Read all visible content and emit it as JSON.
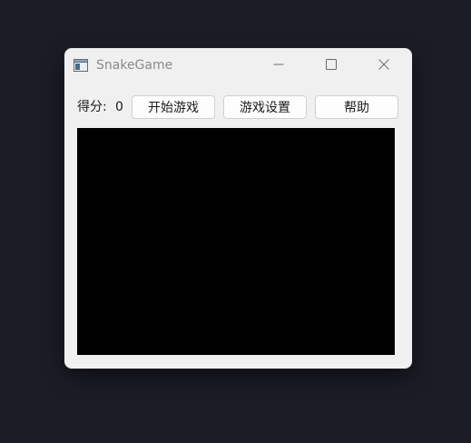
{
  "window": {
    "title": "SnakeGame",
    "app_icon": "window-app-icon",
    "controls": {
      "minimize_icon": "minimize-icon",
      "maximize_icon": "maximize-icon",
      "close_icon": "close-icon"
    }
  },
  "toolbar": {
    "score_label": "得分:",
    "score_value": "0",
    "start_label": "开始游戏",
    "settings_label": "游戏设置",
    "help_label": "帮助"
  },
  "colors": {
    "desktop_background": "#1c1c26",
    "window_background": "#f0f0f0",
    "game_area_background": "#000000",
    "button_background": "#fdfdfd",
    "button_border": "#d0d0d0"
  }
}
